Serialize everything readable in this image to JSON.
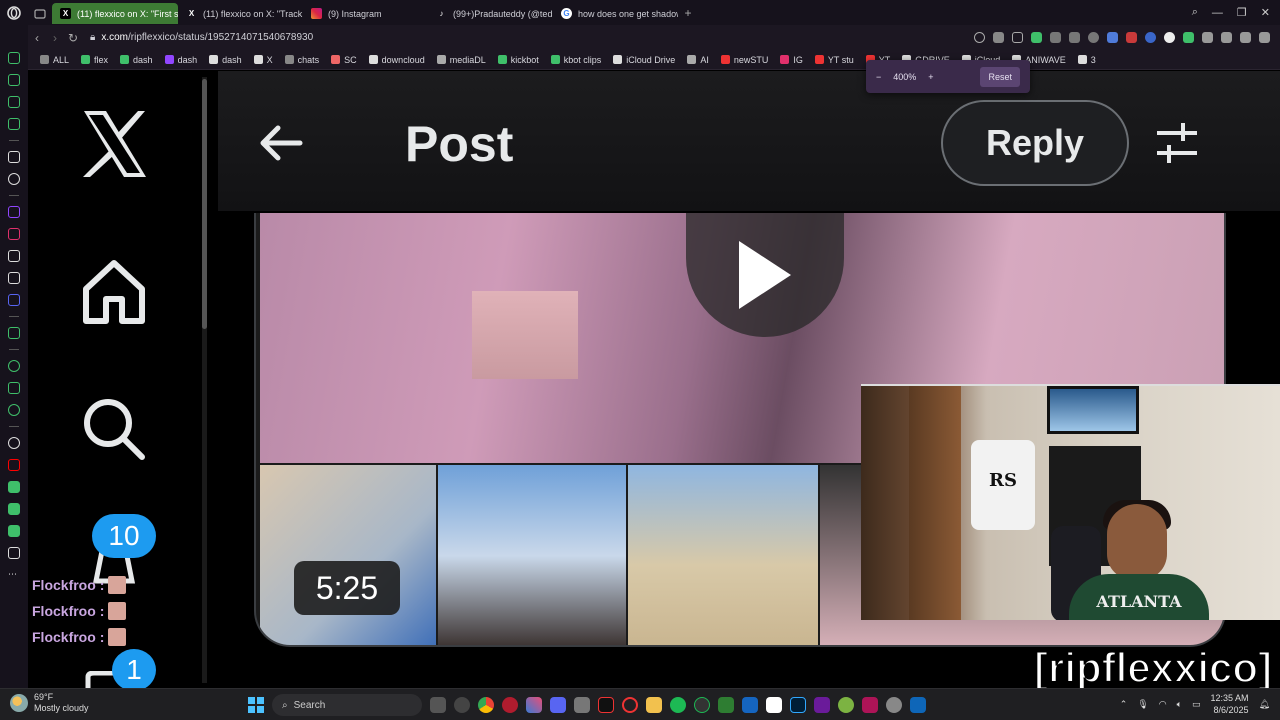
{
  "browser": {
    "tabs": [
      {
        "title": "(11) flexxico on X: \"First s",
        "active": true,
        "icon": "x-icon"
      },
      {
        "title": "(11) flexxico on X: \"Track",
        "active": false,
        "icon": "x-icon"
      },
      {
        "title": "(9) Instagram",
        "active": false,
        "icon": "instagram-icon"
      },
      {
        "title": "(99+)Pradauteddy (@ted",
        "active": false,
        "icon": "tiktok-icon"
      },
      {
        "title": "how does one get shadow",
        "active": false,
        "icon": "google-icon"
      }
    ],
    "url_host": "x.com",
    "url_path": "/ripflexxico/status/1952714071540678930",
    "bookmarks": [
      "ALL",
      "flex",
      "dash",
      "dash",
      "dash",
      "X",
      "chats",
      "SC",
      "downcloud",
      "mediaDL",
      "kickbot",
      "kbot clips",
      "iCloud Drive",
      "AI",
      "newSTU",
      "IG",
      "YT stu",
      "YT",
      "GDRIVE",
      "iCloud",
      "ANIWAVE",
      "3"
    ],
    "zoom": {
      "level": "400%",
      "minus": "−",
      "plus": "+",
      "reset": "Reset"
    }
  },
  "page": {
    "title": "Post",
    "reply_label": "Reply",
    "video_duration": "5:25",
    "notif_badge": "10",
    "msg_badge": "1"
  },
  "stream": {
    "watermark": "[ripflexxico]",
    "chat": [
      {
        "user": "Flockfroo",
        "sep": ":"
      },
      {
        "user": "Flockfroo",
        "sep": ":"
      },
      {
        "user": "Flockfroo",
        "sep": ":"
      }
    ],
    "shirt_text": "ATLANTA",
    "hoodie_text": "RS"
  },
  "taskbar": {
    "temp": "69°F",
    "weather": "Mostly cloudy",
    "search_label": "Search",
    "time": "12:35 AM",
    "date": "8/6/2025"
  },
  "colors": {
    "accent_tab": "#3d7a34",
    "x_blue": "#1d9bf0",
    "opera_green": "#3fbf6a"
  }
}
